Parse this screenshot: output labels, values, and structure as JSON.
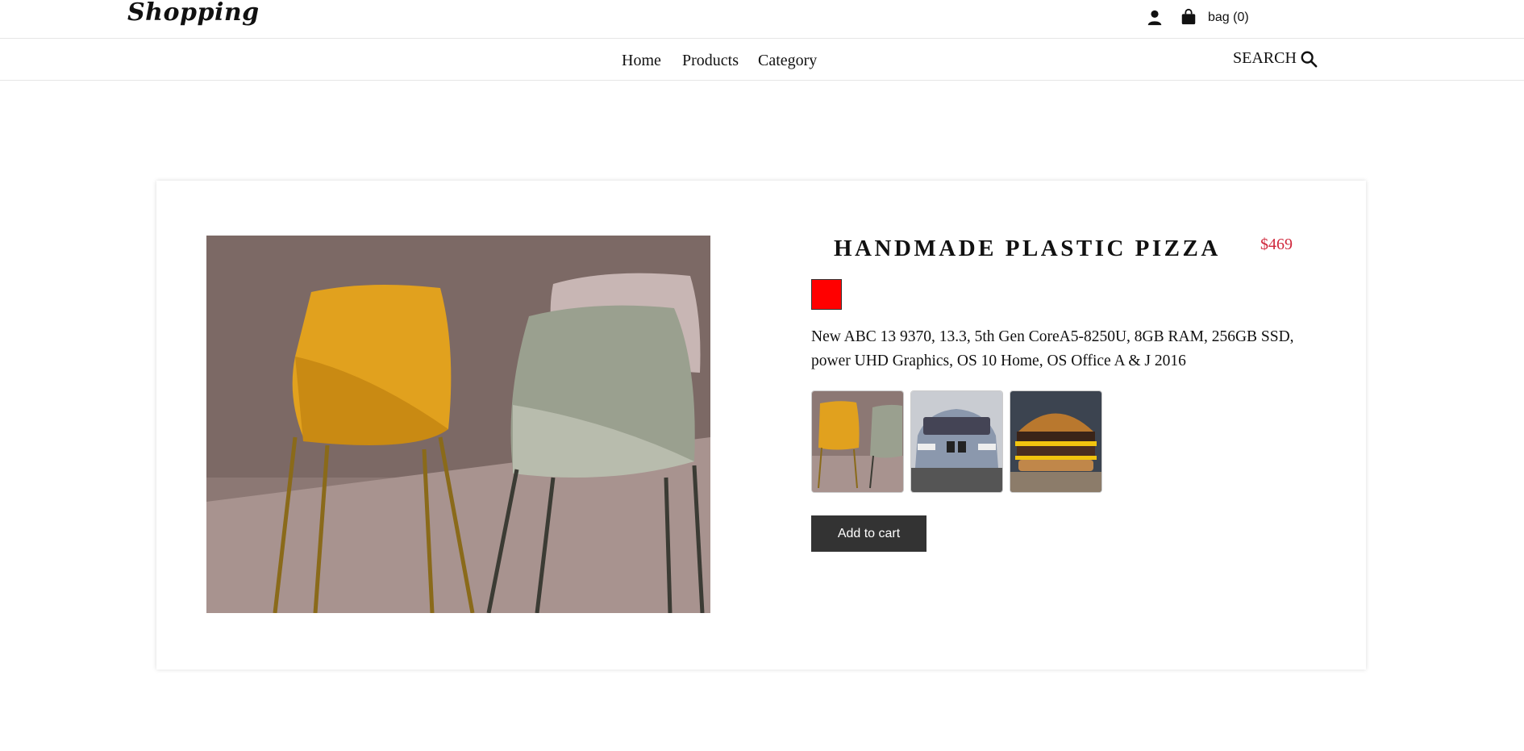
{
  "header": {
    "logo": "Shopping",
    "bag_label": "bag (0)"
  },
  "nav": {
    "items": [
      "Home",
      "Products",
      "Category"
    ],
    "search_label": "SEARCH"
  },
  "product": {
    "title": "HANDMADE PLASTIC PIZZA",
    "price": "$469",
    "color": "#ff0000",
    "description": "New ABC 13 9370, 13.3, 5th Gen CoreA5-8250U, 8GB RAM, 256GB SSD, power UHD Graphics, OS 10 Home, OS Office A & J 2016",
    "thumbnails": [
      "chairs",
      "car",
      "burger"
    ],
    "add_to_cart_label": "Add to cart"
  },
  "colors": {
    "price": "#d0283c",
    "button_bg": "#333333"
  }
}
